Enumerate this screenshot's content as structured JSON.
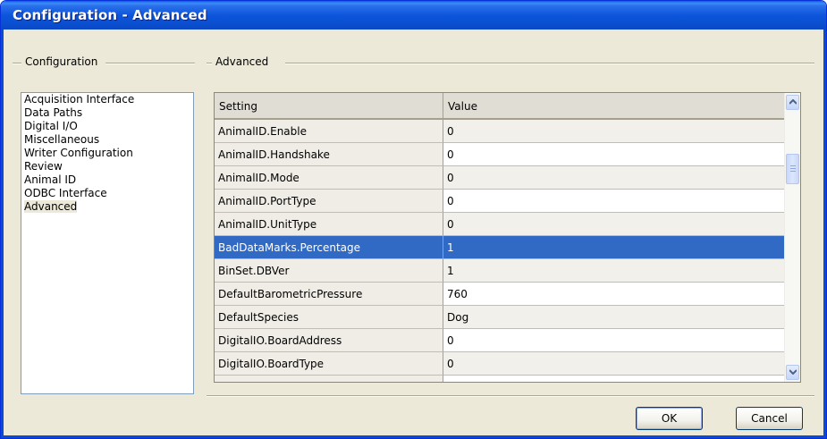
{
  "window": {
    "title": "Configuration - Advanced"
  },
  "config_group": {
    "label": "Configuration"
  },
  "advanced_group": {
    "label": "Advanced"
  },
  "nav": {
    "items": [
      {
        "label": "Acquisition Interface"
      },
      {
        "label": "Data Paths"
      },
      {
        "label": "Digital I/O"
      },
      {
        "label": "Miscellaneous"
      },
      {
        "label": "Writer Configuration"
      },
      {
        "label": "Review"
      },
      {
        "label": "Animal ID"
      },
      {
        "label": "ODBC Interface"
      },
      {
        "label": "Advanced"
      }
    ],
    "selected": "Advanced"
  },
  "grid": {
    "headers": {
      "setting": "Setting",
      "value": "Value"
    },
    "rows": [
      {
        "setting": "AnimalID.Enable",
        "value": "0"
      },
      {
        "setting": "AnimalID.Handshake",
        "value": "0"
      },
      {
        "setting": "AnimalID.Mode",
        "value": "0"
      },
      {
        "setting": "AnimalID.PortType",
        "value": "0"
      },
      {
        "setting": "AnimalID.UnitType",
        "value": "0"
      },
      {
        "setting": "BadDataMarks.Percentage",
        "value": "1"
      },
      {
        "setting": "BinSet.DBVer",
        "value": "1"
      },
      {
        "setting": "DefaultBarometricPressure",
        "value": "760"
      },
      {
        "setting": "DefaultSpecies",
        "value": "Dog"
      },
      {
        "setting": "DigitalIO.BoardAddress",
        "value": "0"
      },
      {
        "setting": "DigitalIO.BoardType",
        "value": "0"
      }
    ],
    "selected_row": "BadDataMarks.Percentage"
  },
  "buttons": {
    "ok": "OK",
    "cancel": "Cancel"
  },
  "colors": {
    "title_bar": "#0A4FD0",
    "selection": "#316AC5",
    "dialog_bg": "#ECE9D8"
  }
}
